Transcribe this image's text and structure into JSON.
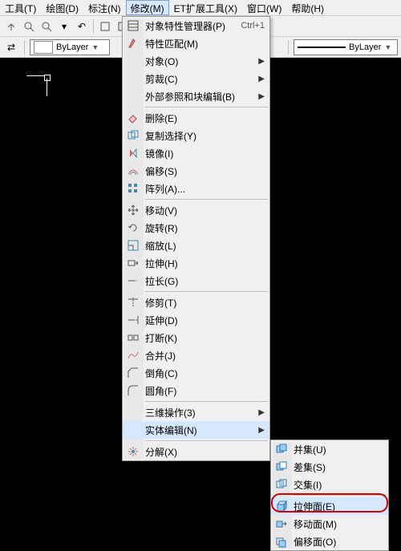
{
  "menubar": {
    "items": [
      "工具(T)",
      "绘图(D)",
      "标注(N)",
      "修改(M)",
      "ET扩展工具(X)",
      "窗口(W)",
      "帮助(H)"
    ],
    "activeIndex": 3
  },
  "toolbar2": {
    "bylayer1": "ByLayer",
    "bylayer2": "ByLayer"
  },
  "menu_modify": {
    "items": [
      {
        "icon": "properties-icon",
        "label": "对象特性管理器(P)",
        "shortcut": "Ctrl+1"
      },
      {
        "icon": "match-icon",
        "label": "特性匹配(M)"
      },
      {
        "icon": "",
        "label": "对象(O)",
        "submenu": true
      },
      {
        "icon": "",
        "label": "剪裁(C)",
        "submenu": true
      },
      {
        "icon": "",
        "label": "外部参照和块编辑(B)",
        "submenu": true
      },
      {
        "sep": true
      },
      {
        "icon": "erase-icon",
        "label": "删除(E)"
      },
      {
        "icon": "copy-icon",
        "label": "复制选择(Y)"
      },
      {
        "icon": "mirror-icon",
        "label": "镜像(I)"
      },
      {
        "icon": "offset-icon",
        "label": "偏移(S)"
      },
      {
        "icon": "array-icon",
        "label": "阵列(A)..."
      },
      {
        "sep": true
      },
      {
        "icon": "move-icon",
        "label": "移动(V)"
      },
      {
        "icon": "rotate-icon",
        "label": "旋转(R)"
      },
      {
        "icon": "scale-icon",
        "label": "缩放(L)"
      },
      {
        "icon": "stretch-icon",
        "label": "拉伸(H)"
      },
      {
        "icon": "lengthen-icon",
        "label": "拉长(G)"
      },
      {
        "sep": true
      },
      {
        "icon": "trim-icon",
        "label": "修剪(T)"
      },
      {
        "icon": "extend-icon",
        "label": "延伸(D)"
      },
      {
        "icon": "break-icon",
        "label": "打断(K)"
      },
      {
        "icon": "join-icon",
        "label": "合并(J)"
      },
      {
        "icon": "chamfer-icon",
        "label": "倒角(C)"
      },
      {
        "icon": "fillet-icon",
        "label": "圆角(F)"
      },
      {
        "sep": true
      },
      {
        "icon": "",
        "label": "三维操作(3)",
        "submenu": true
      },
      {
        "icon": "",
        "label": "实体编辑(N)",
        "submenu": true,
        "hov": true
      },
      {
        "sep": true
      },
      {
        "icon": "explode-icon",
        "label": "分解(X)"
      }
    ]
  },
  "menu_solid_edit": {
    "items": [
      {
        "icon": "union-icon",
        "label": "并集(U)"
      },
      {
        "icon": "subtract-icon",
        "label": "差集(S)"
      },
      {
        "icon": "intersect-icon",
        "label": "交集(I)"
      },
      {
        "sep": true
      },
      {
        "icon": "extrude-face-icon",
        "label": "拉伸面(E)",
        "hov": true
      },
      {
        "icon": "move-face-icon",
        "label": "移动面(M)"
      },
      {
        "icon": "offset-face-icon",
        "label": "偏移面(O)"
      }
    ]
  }
}
